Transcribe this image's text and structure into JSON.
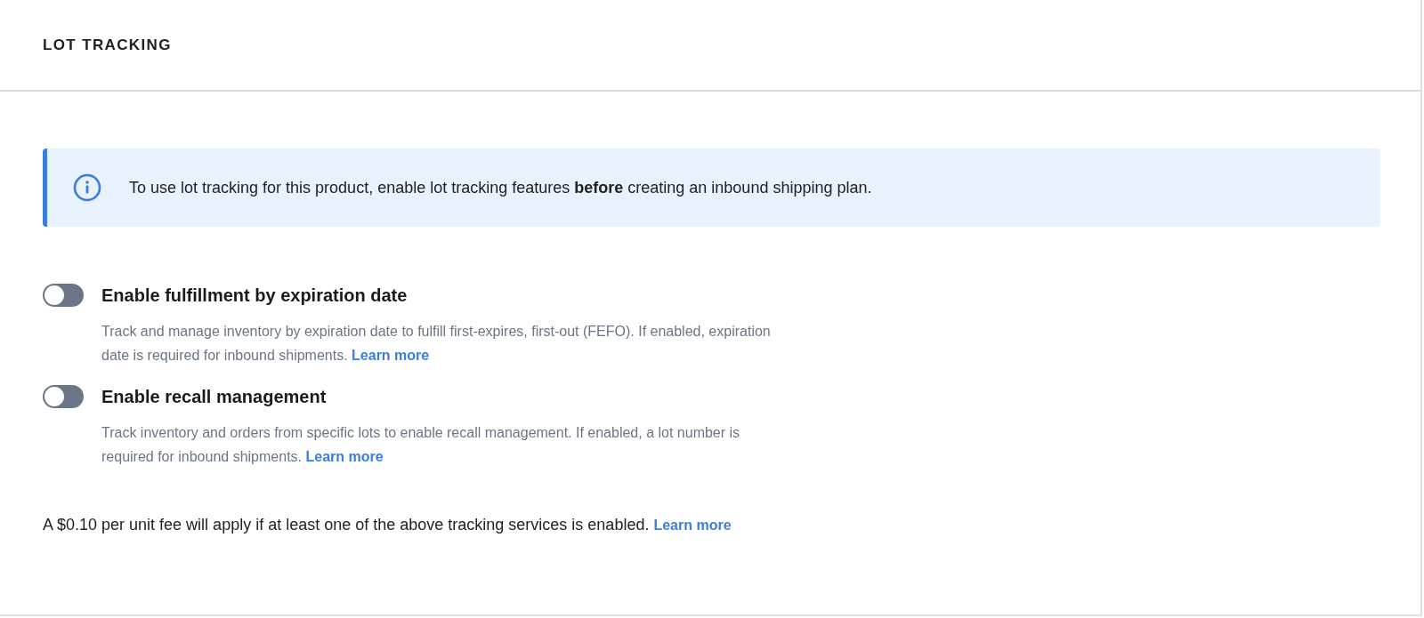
{
  "section": {
    "title": "LOT TRACKING"
  },
  "info_banner": {
    "text": "To use lot tracking for this product, enable lot tracking features **before** creating an inbound shipping plan."
  },
  "settings": [
    {
      "label": "Enable fulfillment by expiration date",
      "on": false,
      "description": "Track and manage inventory by expiration date to fulfill first-expires, first-out (FEFO). If enabled, expiration date is required for inbound shipments.",
      "link": "Learn more"
    },
    {
      "label": "Enable recall management",
      "on": false,
      "description": "Track inventory and orders from specific lots to enable recall management. If enabled, a lot number is required for inbound shipments.",
      "link": "Learn more"
    }
  ],
  "fee_note": {
    "text": "A $0.10 per unit fee will apply if at least one of the above tracking services is enabled.",
    "link": "Learn more"
  }
}
